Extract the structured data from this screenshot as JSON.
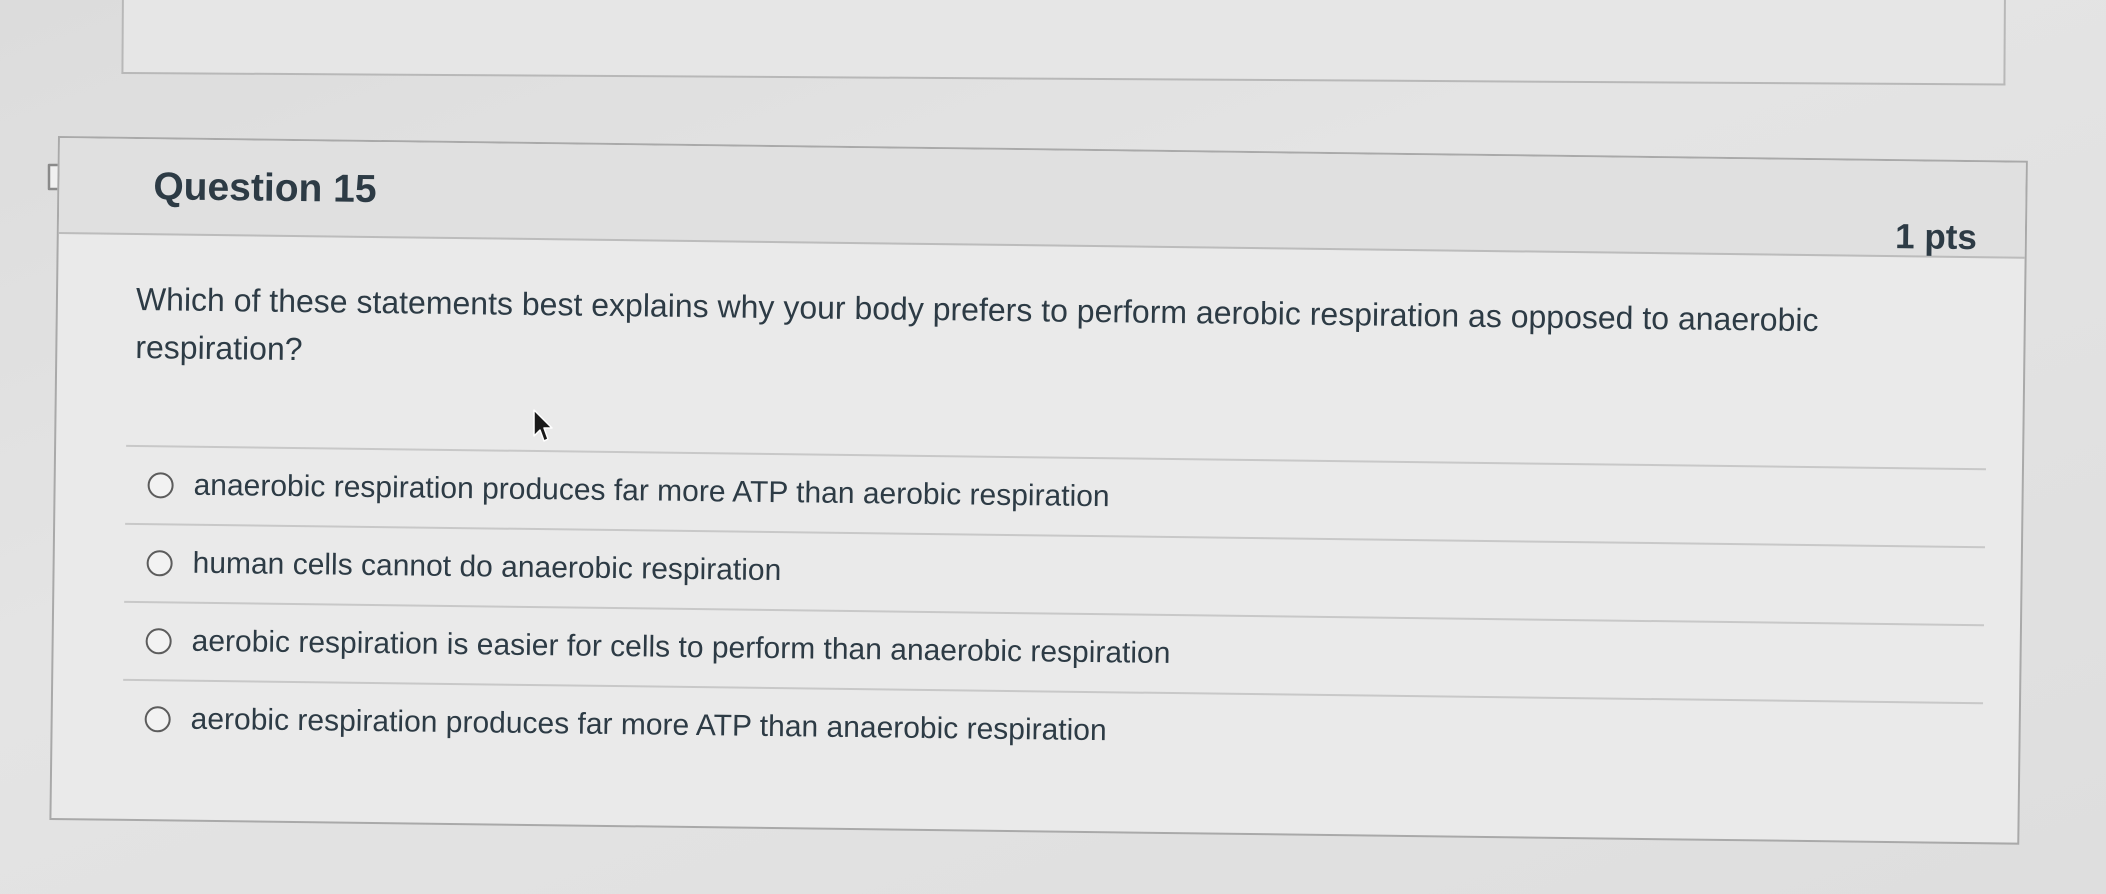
{
  "question": {
    "title": "Question 15",
    "points": "1 pts",
    "text": "Which of these statements best explains why your body prefers to perform aerobic respiration as opposed to anaerobic respiration?",
    "answers": [
      {
        "label": "anaerobic respiration produces far more ATP than aerobic respiration"
      },
      {
        "label": "human cells cannot do anaerobic respiration"
      },
      {
        "label": "aerobic respiration is easier for cells to perform than anaerobic respiration"
      },
      {
        "label": "aerobic respiration produces far more ATP than anaerobic respiration"
      }
    ]
  },
  "icons": {
    "flag": "flag-bookmark-icon",
    "pointer": "mouse-pointer-icon"
  },
  "colors": {
    "text": "#2d3b45",
    "header_bg": "#e0e0e0",
    "card_bg": "#eaeaea",
    "border": "#a9a9a9"
  }
}
